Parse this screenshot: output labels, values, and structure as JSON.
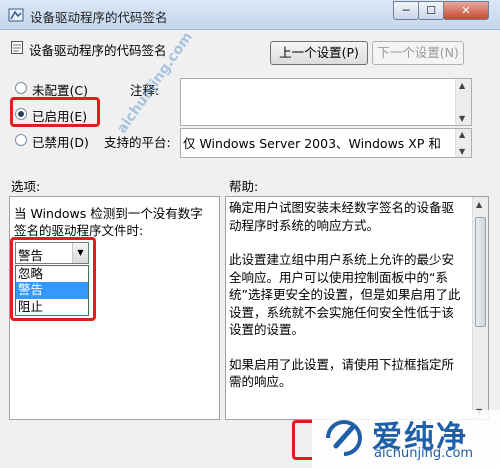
{
  "window": {
    "title": "设备驱动程序的代码签名",
    "minimize": "─",
    "maximize": "☐",
    "close": "✕"
  },
  "policy": {
    "title": "设备驱动程序的代码签名"
  },
  "nav": {
    "prev_label": "上一个设置(P)",
    "next_label": "下一个设置(N)"
  },
  "state": {
    "options": [
      {
        "label": "未配置(C)",
        "checked": false
      },
      {
        "label": "已启用(E)",
        "checked": true
      },
      {
        "label": "已禁用(D)",
        "checked": false
      }
    ]
  },
  "comment": {
    "label": "注释:",
    "value": ""
  },
  "platform": {
    "label": "支持的平台:",
    "value": "仅 Windows Server 2003、Windows XP 和"
  },
  "options_panel": {
    "label": "选项:",
    "description": "当 Windows 检测到一个没有数字签名的驱动程序文件时:",
    "combo_value": "警告",
    "dropdown_items": [
      {
        "label": "忽略",
        "selected": false
      },
      {
        "label": "警告",
        "selected": true
      },
      {
        "label": "阻止",
        "selected": false
      }
    ]
  },
  "help_panel": {
    "label": "帮助:",
    "paragraphs": [
      "确定用户试图安装未经数字签名的设备驱动程序时系统的响应方式。",
      "此设置建立组中用户系统上允许的最少安全响应。用户可以使用控制面板中的“系统”选择更安全的设置，但是如果启用了此设置，系统就不会实施任何安全性低于该设置的设置。",
      "如果启用了此设置，请使用下拉框指定所需的响应。"
    ]
  },
  "watermark": {
    "text": "aichunjing.com"
  },
  "logo": {
    "name": "爱纯净",
    "url": "aichunjing.com",
    "color": "#1e5fa7"
  },
  "colors": {
    "highlight": "#e31c1c",
    "selection": "#3399ff"
  }
}
